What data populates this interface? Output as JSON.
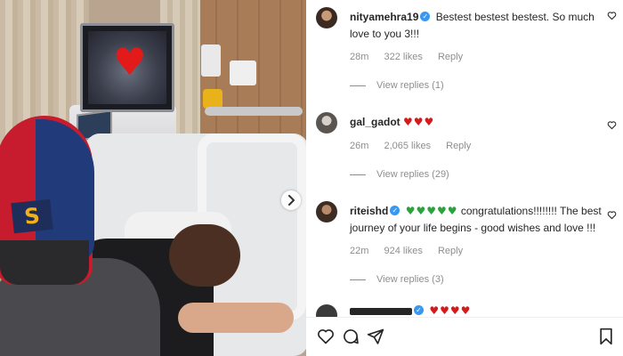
{
  "comments": [
    {
      "username": "nityamehra19",
      "verified": true,
      "text": "Bestest bestest bestest. So much love to you 3!!!",
      "time": "28m",
      "likes": "322 likes",
      "reply": "Reply",
      "view_replies": "View replies (1)"
    },
    {
      "username": "gal_gadot",
      "verified": false,
      "hearts": "♥♥♥",
      "time": "26m",
      "likes": "2,065 likes",
      "reply": "Reply",
      "view_replies": "View replies (29)"
    },
    {
      "username": "riteishd",
      "verified": true,
      "green_hearts": "♥♥♥♥♥",
      "text": "congratulations!!!!!!!! The best journey of your life begins - good wishes and love !!!",
      "time": "22m",
      "likes": "924 likes",
      "reply": "Reply",
      "view_replies": "View replies (3)"
    },
    {
      "partial_hearts": "♥♥♥♥"
    }
  ],
  "photo": {
    "screen_emoji": "♥",
    "cap_logo": "S"
  },
  "icons": {
    "like": "heart-outline-icon",
    "comment": "comment-icon",
    "share": "share-icon",
    "save": "bookmark-icon",
    "next": "chevron-right-icon"
  },
  "colors": {
    "verified": "#3897f0",
    "heart_red": "#d41b1b",
    "heart_green": "#2aa33c",
    "meta_gray": "#8e8e8e"
  }
}
